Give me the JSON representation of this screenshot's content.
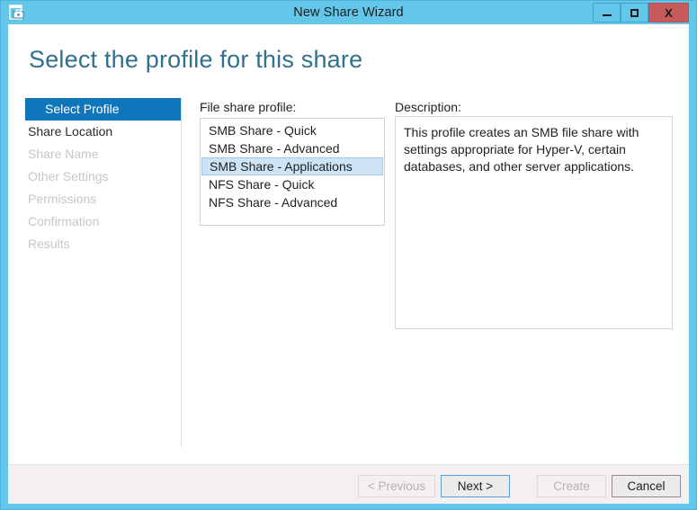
{
  "window": {
    "title": "New Share Wizard",
    "icon": "share-wizard-icon",
    "controls": {
      "minimize": "minimize-icon",
      "maximize": "maximize-icon",
      "close_label": "X"
    },
    "accent_color": "#64c6e8",
    "close_color": "#c75b5b"
  },
  "page": {
    "heading": "Select the profile for this share",
    "heading_color": "#31708f"
  },
  "sidebar": {
    "steps": [
      {
        "label": "Select Profile",
        "state": "active"
      },
      {
        "label": "Share Location",
        "state": "enabled"
      },
      {
        "label": "Share Name",
        "state": "disabled"
      },
      {
        "label": "Other Settings",
        "state": "disabled"
      },
      {
        "label": "Permissions",
        "state": "disabled"
      },
      {
        "label": "Confirmation",
        "state": "disabled"
      },
      {
        "label": "Results",
        "state": "disabled"
      }
    ],
    "active_color": "#0f76bc"
  },
  "main": {
    "profile_label": "File share profile:",
    "profiles": [
      {
        "label": "SMB Share - Quick",
        "selected": false
      },
      {
        "label": "SMB Share - Advanced",
        "selected": false
      },
      {
        "label": "SMB Share - Applications",
        "selected": true
      },
      {
        "label": "NFS Share - Quick",
        "selected": false
      },
      {
        "label": "NFS Share - Advanced",
        "selected": false
      }
    ],
    "selection_color": "#cde4f7",
    "description_label": "Description:",
    "description_text": "This profile creates an SMB file share with settings appropriate for Hyper-V, certain databases, and other server applications."
  },
  "footer": {
    "buttons": [
      {
        "label": "< Previous",
        "state": "disabled"
      },
      {
        "label": "Next >",
        "state": "default"
      },
      {
        "label": "Create",
        "state": "disabled"
      },
      {
        "label": "Cancel",
        "state": "normal"
      }
    ]
  }
}
